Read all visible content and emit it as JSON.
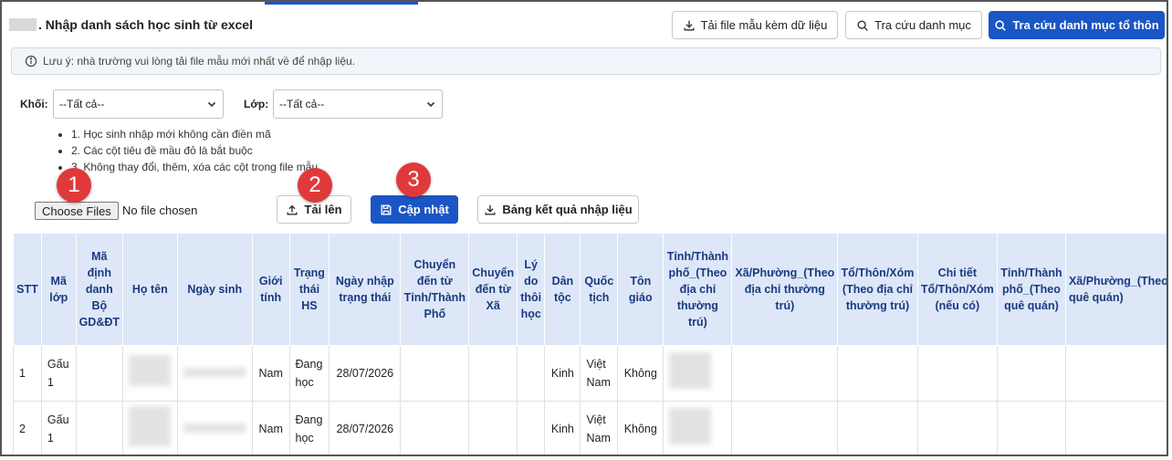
{
  "header": {
    "title": ". Nhập danh sách học sinh từ excel",
    "btn_download_template": "Tải file mẫu kèm dữ liệu",
    "btn_lookup_category": "Tra cứu danh mục",
    "btn_lookup_hamlet": "Tra cứu danh mục tổ thôn"
  },
  "note": {
    "text": "Lưu ý: nhà trường vui lòng tải file mẫu mới nhất về để nhập liệu."
  },
  "filters": {
    "grade_label": "Khối:",
    "grade_value": "--Tất cả--",
    "class_label": "Lớp:",
    "class_value": "--Tất cả--"
  },
  "rules": [
    "1. Học sinh nhập mới không cần điền mã",
    "2. Các cột tiêu đề mầu đỏ là bắt buộc",
    "3. Không thay đổi, thêm, xóa các cột trong file mẫu"
  ],
  "upload": {
    "choose_label": "Choose Files",
    "no_file": "No file chosen",
    "btn_upload": "Tải lên",
    "btn_update": "Cập nhật",
    "btn_result": "Bảng kết quả nhập liệu"
  },
  "badges": [
    "1",
    "2",
    "3"
  ],
  "table": {
    "headers": [
      "STT",
      "Mã lớp",
      "Mã định danh Bộ GD&ĐT",
      "Họ tên",
      "Ngày sinh",
      "Giới tính",
      "Trạng thái HS",
      "Ngày nhập trạng thái",
      "Chuyển đến từ Tỉnh/Thành Phố",
      "Chuyển đến từ Xã",
      "Lý do thôi học",
      "Dân tộc",
      "Quốc tịch",
      "Tôn giáo",
      "Tỉnh/Thành phố_(Theo địa chỉ thường trú)",
      "Xã/Phường_(Theo địa chỉ thường trú)",
      "Tổ/Thôn/Xóm (Theo địa chỉ thường trú)",
      "Chi tiết Tổ/Thôn/Xóm (nếu có)",
      "Tỉnh/Thành phố_(Theo quê quán)",
      "Xã/Phường_(Theo quê quán)"
    ],
    "rows": [
      [
        "1",
        "Gấu 1",
        "",
        "",
        "",
        "Nam",
        "Đang học",
        "28/07/2026",
        "",
        "",
        "",
        "Kinh",
        "Việt Nam",
        "Không",
        "",
        "",
        "",
        "",
        "",
        ""
      ],
      [
        "2",
        "Gấu 1",
        "",
        "",
        "",
        "Nam",
        "Đang học",
        "28/07/2026",
        "",
        "",
        "",
        "Kinh",
        "Việt Nam",
        "Không",
        "",
        "",
        "",
        "",
        "",
        ""
      ]
    ]
  },
  "colors": {
    "primary": "#1a56c4",
    "header_bg": "#dde7f7",
    "header_text": "#1a3a80",
    "badge": "#e0393b",
    "note_bg": "#f2f5fa"
  }
}
